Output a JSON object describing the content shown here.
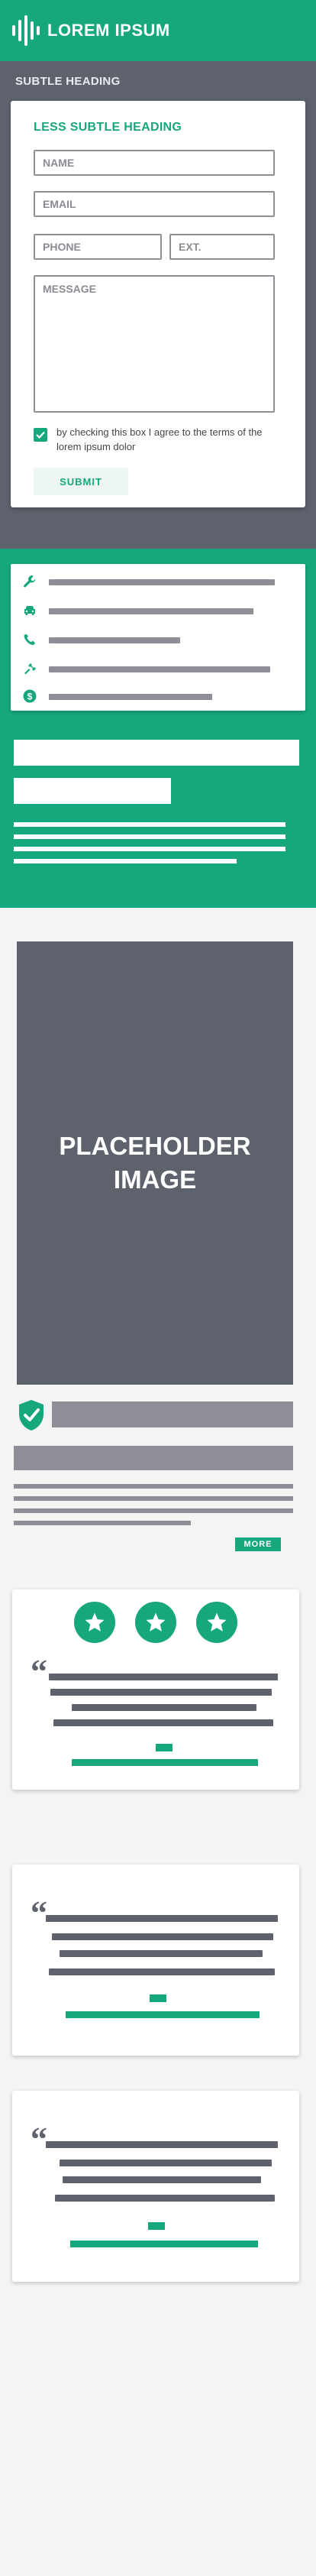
{
  "brand": {
    "name": "LOREM IPSUM",
    "accent_color": "#16a77c",
    "dark_color": "#5e626d"
  },
  "form_section": {
    "subtle_heading": "SUBTLE HEADING",
    "card_heading": "LESS SUBTLE HEADING",
    "name_placeholder": "NAME",
    "email_placeholder": "EMAIL",
    "phone_placeholder": "PHONE",
    "ext_placeholder": "EXT.",
    "message_placeholder": "MESSAGE",
    "consent_text": "by checking this box I agree to the terms of the lorem ipsum dolor",
    "consent_checked": true,
    "submit_label": "SUBMIT"
  },
  "features": {
    "icons": [
      "wrench-icon",
      "car-icon",
      "phone-icon",
      "tools-icon",
      "dollar-icon"
    ]
  },
  "placeholder": {
    "label": "PLACEHOLDER\nIMAGE"
  },
  "info_block": {
    "icon": "shield-check-icon",
    "more_label": "MORE"
  },
  "testimonials": [
    {
      "stars": 3,
      "quote_icon": "quote-icon"
    },
    {
      "stars": 0,
      "quote_icon": "quote-icon"
    },
    {
      "stars": 0,
      "quote_icon": "quote-icon"
    }
  ]
}
